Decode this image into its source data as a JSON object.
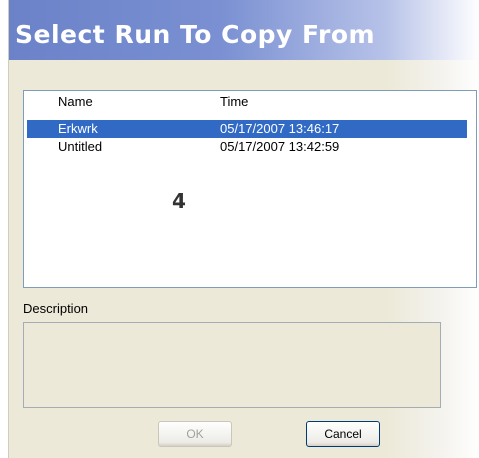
{
  "dialog": {
    "title": "Select Run To Copy From"
  },
  "runs_list": {
    "columns": {
      "name": "Name",
      "time": "Time"
    },
    "rows": [
      {
        "name": "Erkwrk",
        "time": "05/17/2007 13:46:17",
        "selected": true
      },
      {
        "name": "Untitled",
        "time": "05/17/2007 13:42:59",
        "selected": false
      }
    ],
    "marker": "4"
  },
  "description": {
    "label": "Description",
    "value": ""
  },
  "buttons": {
    "ok": "OK",
    "cancel": "Cancel"
  },
  "colors": {
    "title_bar": "#7a90d2",
    "selection": "#316ac5",
    "dialog_bg": "#ece9d8"
  }
}
